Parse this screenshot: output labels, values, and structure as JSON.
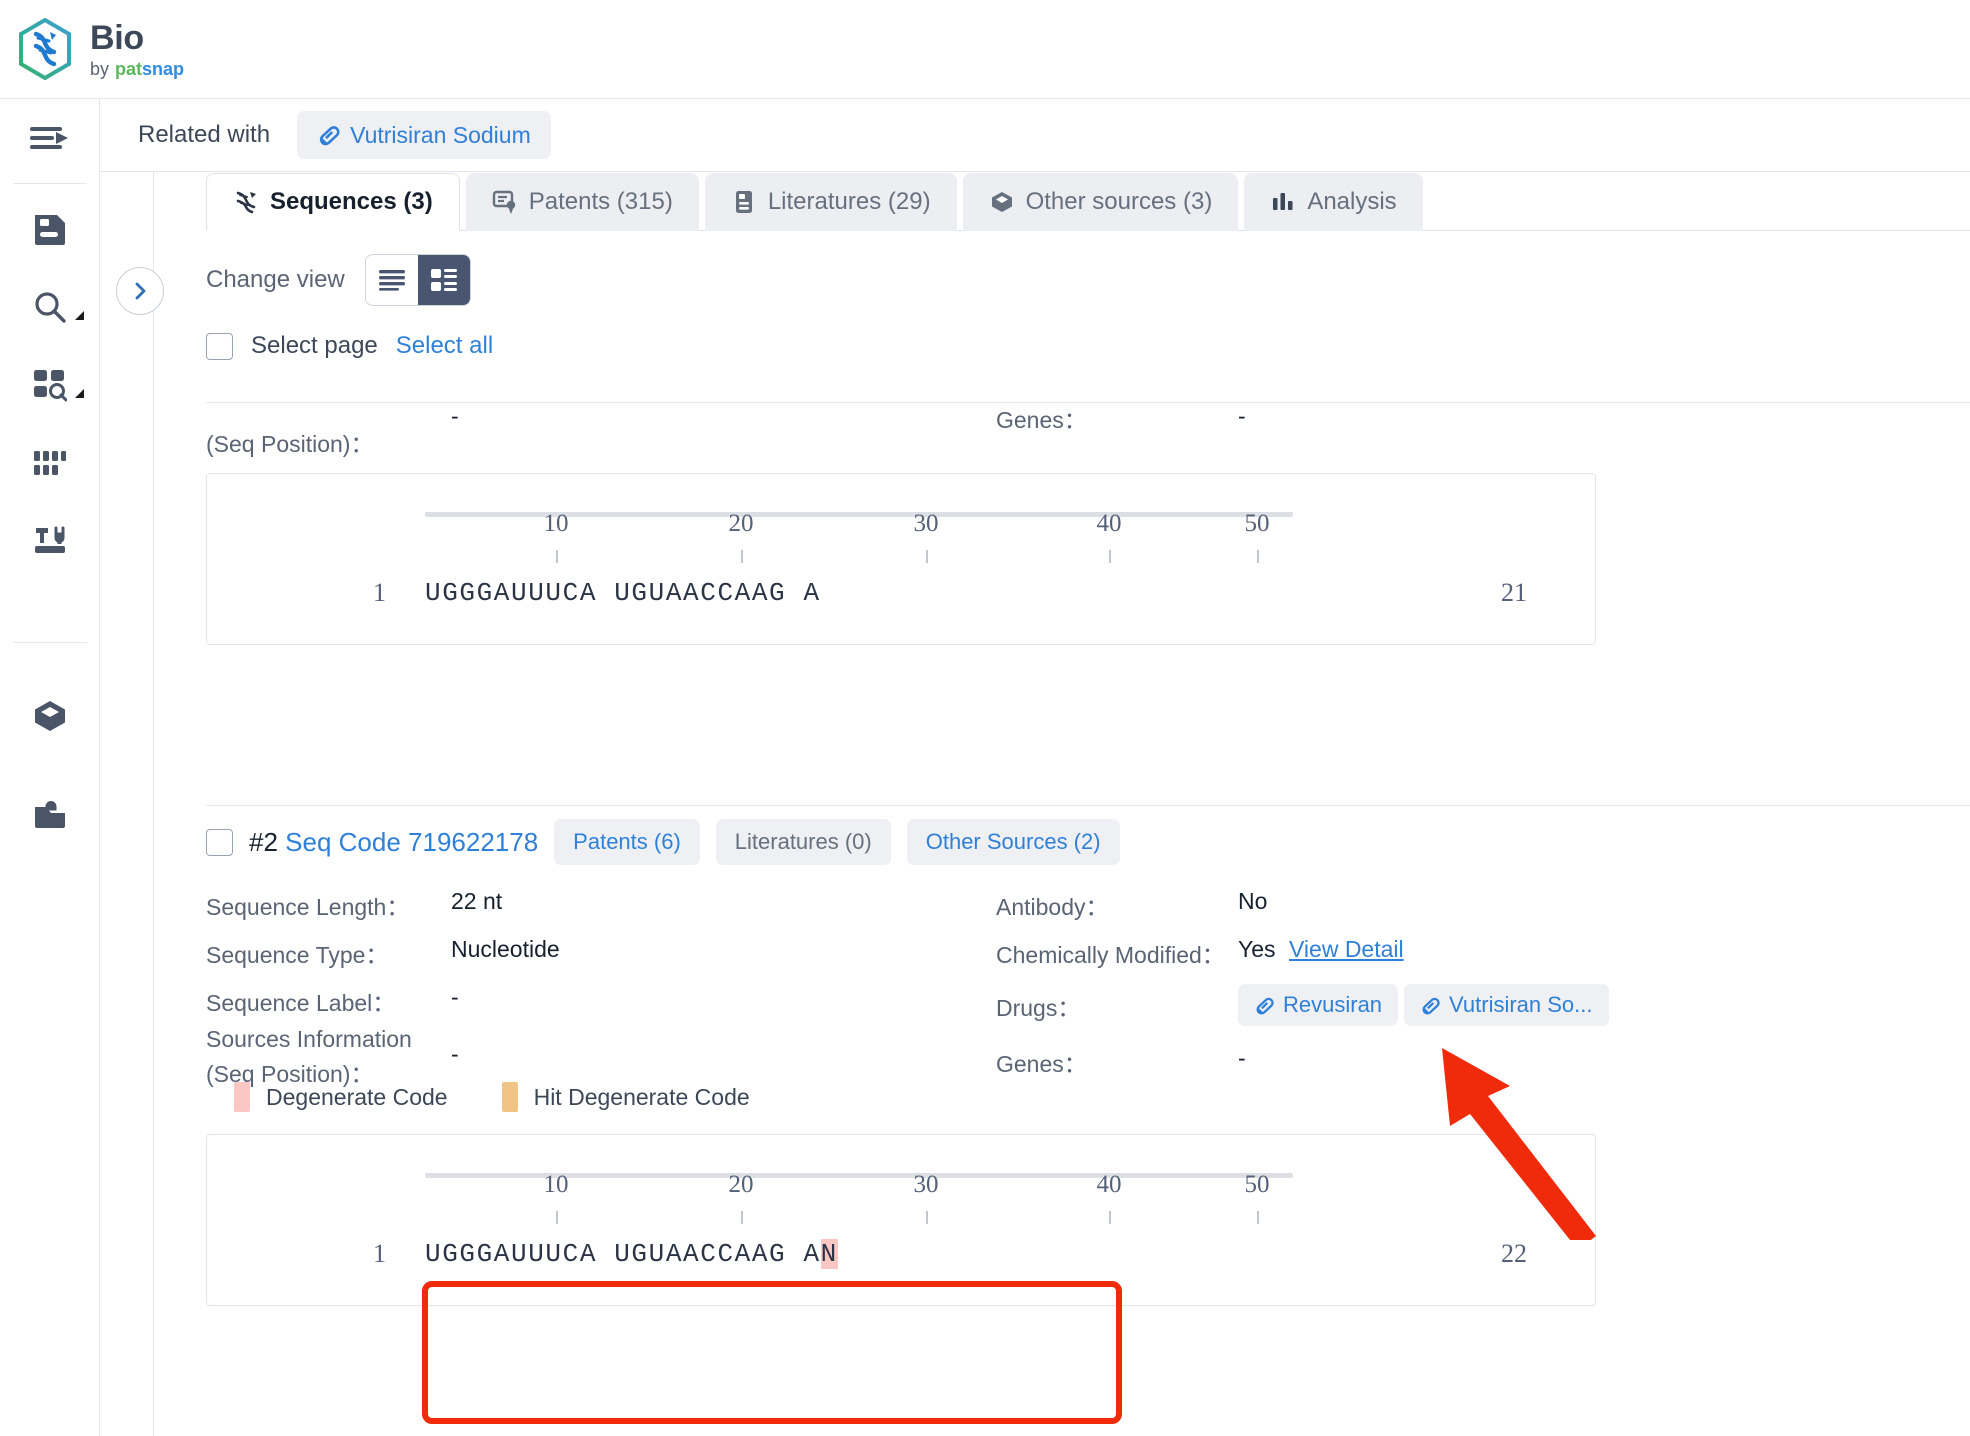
{
  "brand": {
    "title": "Bio",
    "by": "by",
    "pat": "pat",
    "snap": "snap",
    "logo_icon": "dna-hexagon-logo"
  },
  "rail": {
    "items": [
      {
        "icon": "menu-expand-icon",
        "name": "menu-toggle"
      },
      {
        "icon": "document-save-icon",
        "name": "saved-documents"
      },
      {
        "icon": "search-icon",
        "name": "search",
        "caret": true
      },
      {
        "icon": "grid-search-icon",
        "name": "advanced-search",
        "caret": true
      },
      {
        "icon": "barcode-columns-icon",
        "name": "sequence-columns"
      },
      {
        "icon": "tools-icon",
        "name": "tools"
      },
      {
        "icon": "cube-icon",
        "name": "workspace"
      },
      {
        "icon": "inbox-alert-icon",
        "name": "notifications"
      }
    ]
  },
  "related": {
    "label": "Related with",
    "chip_label": "Vutrisiran Sodium",
    "chip_icon": "pill-icon"
  },
  "collapse_button": {
    "icon": "chevron-right-icon"
  },
  "tabs": [
    {
      "label": "Sequences (3)",
      "icon": "dna-icon",
      "active": true
    },
    {
      "label": "Patents (315)",
      "icon": "patent-icon",
      "active": false
    },
    {
      "label": "Literatures (29)",
      "icon": "literature-icon",
      "active": false
    },
    {
      "label": "Other sources (3)",
      "icon": "cube-icon",
      "active": false
    },
    {
      "label": "Analysis",
      "icon": "bar-chart-icon",
      "active": false
    }
  ],
  "toolbar": {
    "change_view_label": "Change view",
    "list_view_icon": "list-view-icon",
    "card_view_icon": "card-view-icon",
    "selected_view": "card"
  },
  "selection": {
    "select_page_label": "Select page",
    "select_all_label": "Select all",
    "checked": false
  },
  "partial_record": {
    "label_left": "(Seq Position)：",
    "value_left": "-",
    "label_right": "Genes：",
    "value_right": "-"
  },
  "sequence_1": {
    "ruler_ticks": [
      "10",
      "20",
      "30",
      "40",
      "50"
    ],
    "start_index": "1",
    "sequence": "UGGGAUUUCA UGUAACCAAG A",
    "end_index": "21"
  },
  "record_2": {
    "index_label": "#2",
    "seq_code": "Seq Code 719622178",
    "buttons": [
      {
        "label": "Patents (6)",
        "muted": false
      },
      {
        "label": "Literatures (0)",
        "muted": true
      },
      {
        "label": "Other Sources (2)",
        "muted": false
      }
    ],
    "fields_left": [
      {
        "label": "Sequence Length：",
        "value": "22 nt"
      },
      {
        "label": "Sequence Type：",
        "value": "Nucleotide"
      },
      {
        "label": "Sequence Label：",
        "value": "-"
      },
      {
        "label": "Sources Information",
        "label2": "(Seq Position)：",
        "value": "-"
      }
    ],
    "fields_right": [
      {
        "label": "Antibody：",
        "value": "No"
      },
      {
        "label": "Chemically Modified：",
        "value": "Yes",
        "link": "View Detail"
      },
      {
        "label": "Drugs：",
        "value": ""
      },
      {
        "label": "Genes：",
        "value": "-"
      }
    ],
    "drug_tags": [
      "Revusiran",
      "Vutrisiran So..."
    ],
    "legend": [
      {
        "label": "Degenerate Code",
        "color": "#fbc7c4"
      },
      {
        "label": "Hit Degenerate Code",
        "color": "#f0c485"
      }
    ],
    "ruler_ticks": [
      "10",
      "20",
      "30",
      "40",
      "50"
    ],
    "start_index": "1",
    "sequence_plain": "UGGGAUUUCA UGUAACCAAG A",
    "sequence_degenerate": "N",
    "end_index": "22"
  },
  "annotation": {
    "highlight_color": "#f02b0c",
    "arrow_color": "#f02b0c",
    "points_at": "View Detail"
  }
}
